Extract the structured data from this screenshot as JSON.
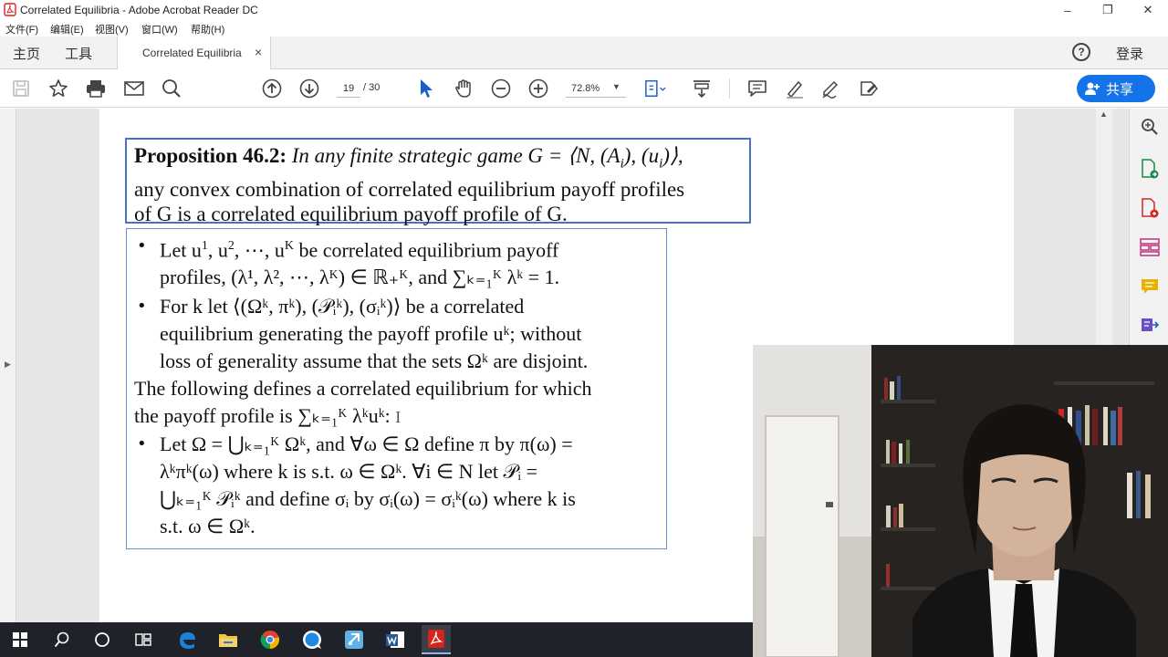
{
  "window": {
    "title": "Correlated Equilibria - Adobe Acrobat Reader DC",
    "minimize": "–",
    "restore": "❐",
    "close": "✕"
  },
  "menu": [
    "文件(F)",
    "编辑(E)",
    "视图(V)",
    "窗口(W)",
    "帮助(H)"
  ],
  "tabs": {
    "home": "主页",
    "tools": "工具",
    "document": "Correlated Equilibria",
    "close": "×",
    "help": "?",
    "login": "登录"
  },
  "toolbar": {
    "page_current": "19",
    "page_total": "/ 30",
    "zoom": "72.8%",
    "share_label": "共享"
  },
  "slide": {
    "prop_title": "Proposition 46.2:",
    "prop_line1": " In any finite strategic game G = ⟨N, (A",
    "prop_i1": "i",
    "prop_mid": "), (u",
    "prop_i2": "i",
    "prop_end": ")⟩,",
    "prop_line2": "any convex combination of correlated equilibrium payoff profiles",
    "prop_line3": "of G is a correlated equilibrium payoff profile of G.",
    "b1_l1a": "Let u",
    "b1_l1b": "1",
    "b1_l1c": ", u",
    "b1_l1d": "2",
    "b1_l1e": ", ⋯, u",
    "b1_l1f": "K",
    "b1_l1g": " be correlated equilibrium payoff",
    "b1_l2": "profiles, (λ¹, λ², ⋯, λᴷ) ∈ ℝ₊ᴷ, and ∑ₖ₌₁ᴷ λᵏ = 1.",
    "b2_l1": "For k let ⟨(Ωᵏ, πᵏ), (𝒫ᵢᵏ), (σᵢᵏ)⟩ be a correlated",
    "b2_l2": "equilibrium generating the payoff profile uᵏ; without",
    "b2_l3": "loss of generality assume that the sets Ωᵏ are disjoint.",
    "mid_l1": "The following defines a correlated equilibrium for which",
    "mid_l2": "the payoff profile is ∑ₖ₌₁ᴷ λᵏuᵏ:",
    "b3_l1": "Let Ω = ⋃ₖ₌₁ᴷ Ωᵏ, and ∀ω ∈ Ω define π by π(ω) =",
    "b3_l2": "λᵏπᵏ(ω) where k is s.t. ω ∈ Ωᵏ. ∀i ∈ N let 𝒫ᵢ =",
    "b3_l3": "⋃ₖ₌₁ᴷ 𝒫ᵢᵏ and define σᵢ by σᵢ(ω) = σᵢᵏ(ω) where k is",
    "b3_l4": "s.t. ω ∈ Ωᵏ."
  },
  "colors": {
    "accent": "#1473e6",
    "prop_border": "#4a6fc7",
    "taskbar": "#1f2229"
  }
}
